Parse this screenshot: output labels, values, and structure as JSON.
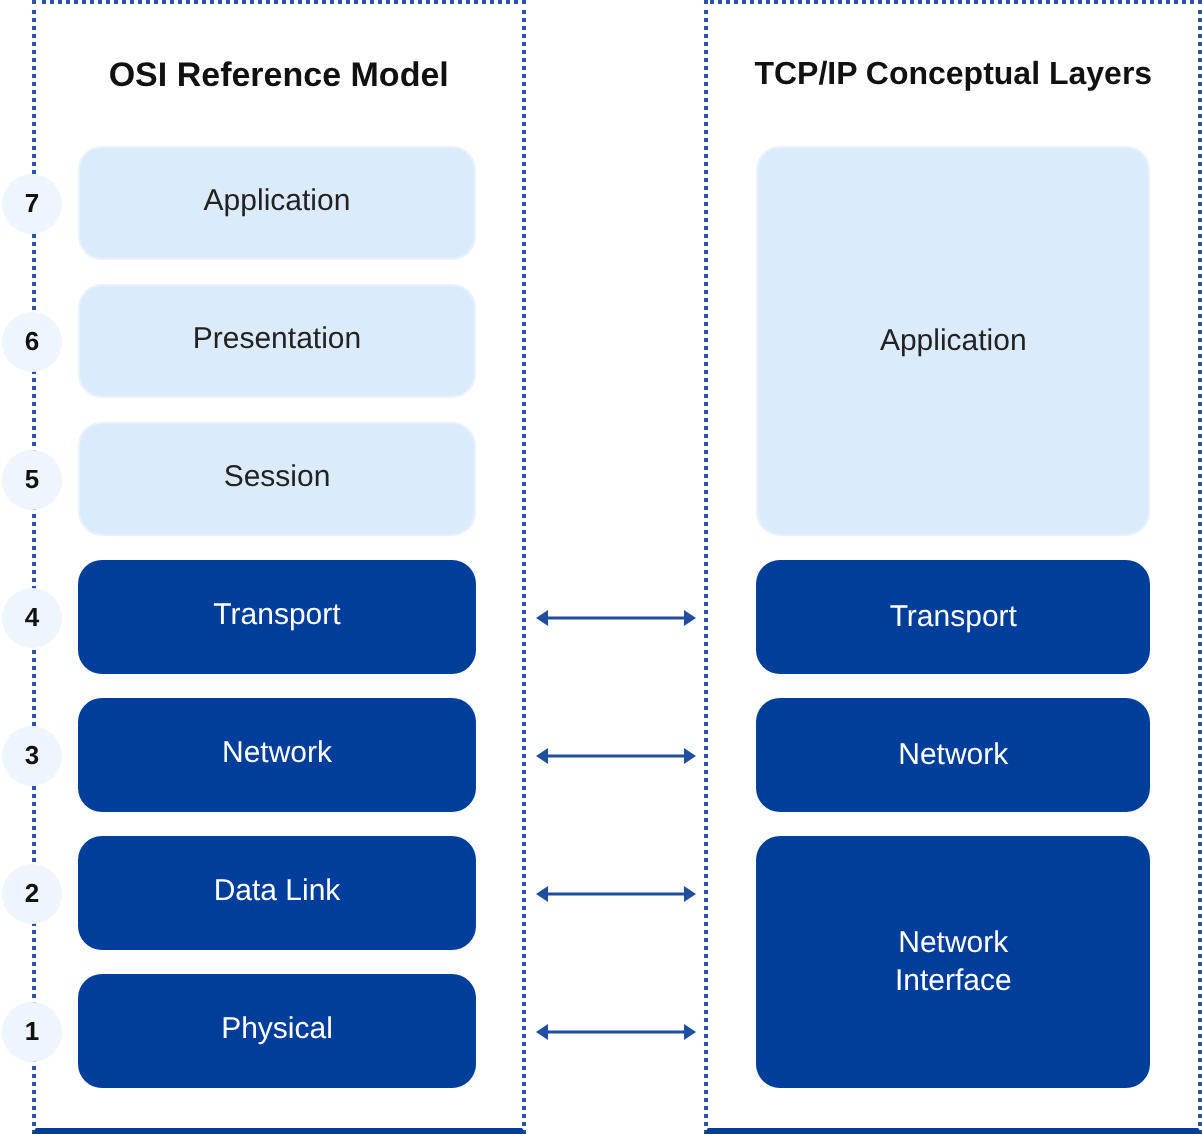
{
  "osi_model": {
    "title": "OSI Reference Model",
    "layers": [
      {
        "number": "7",
        "name": "Application",
        "kind": "upper",
        "linked": false
      },
      {
        "number": "6",
        "name": "Presentation",
        "kind": "upper",
        "linked": false
      },
      {
        "number": "5",
        "name": "Session",
        "kind": "upper",
        "linked": false
      },
      {
        "number": "4",
        "name": "Transport",
        "kind": "lower",
        "linked": true
      },
      {
        "number": "3",
        "name": "Network",
        "kind": "lower",
        "linked": true
      },
      {
        "number": "2",
        "name": "Data Link",
        "kind": "lower",
        "linked": true
      },
      {
        "number": "1",
        "name": "Physical",
        "kind": "lower",
        "linked": true
      }
    ]
  },
  "tcpip_model": {
    "title": "TCP/IP Conceptual Layers",
    "layers": [
      {
        "name": "Application",
        "kind": "tall"
      },
      {
        "name": "Transport",
        "kind": "single"
      },
      {
        "name": "Network",
        "kind": "single"
      },
      {
        "name": "Network\nInterface",
        "kind": "double"
      }
    ]
  }
}
